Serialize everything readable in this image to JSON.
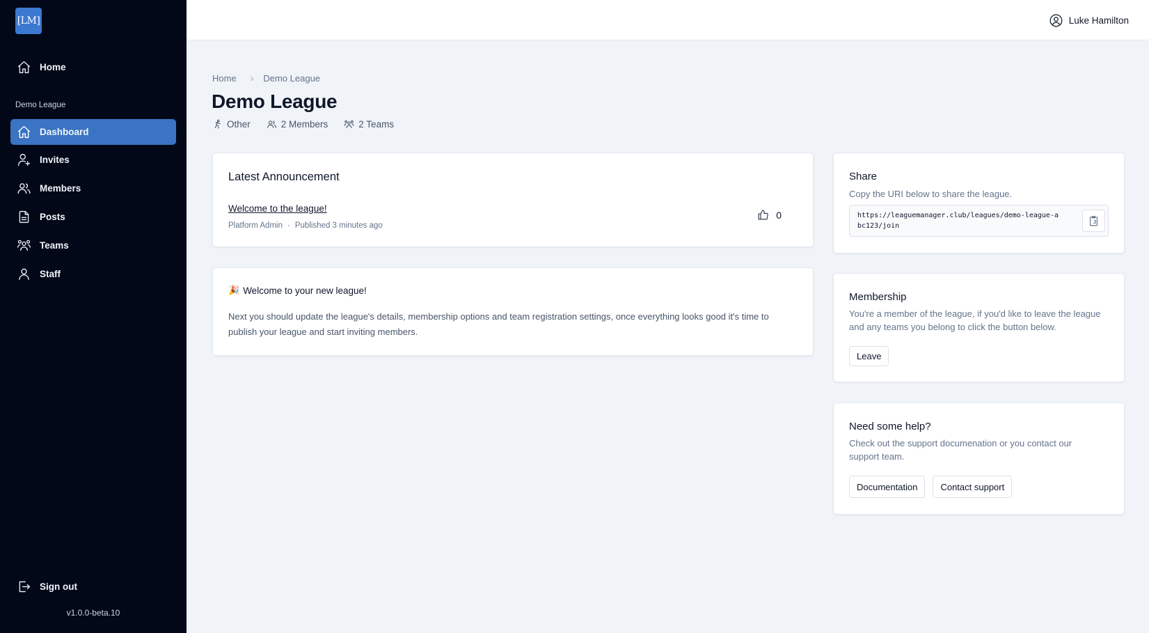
{
  "app": {
    "logo_text": "[LM]",
    "version": "v1.0.0-beta.10"
  },
  "user": {
    "name": "Luke Hamilton"
  },
  "sidebar": {
    "home": "Home",
    "section": "Demo League",
    "items": [
      {
        "label": "Dashboard",
        "icon": "home-icon",
        "active": true
      },
      {
        "label": "Invites",
        "icon": "user-plus-icon"
      },
      {
        "label": "Members",
        "icon": "users-icon"
      },
      {
        "label": "Posts",
        "icon": "document-icon"
      },
      {
        "label": "Teams",
        "icon": "user-group-icon"
      },
      {
        "label": "Staff",
        "icon": "user-icon"
      }
    ],
    "sign_out": "Sign out"
  },
  "breadcrumb": {
    "home": "Home",
    "current": "Demo League"
  },
  "page": {
    "title": "Demo League",
    "meta": {
      "sport": "Other",
      "members": "2 Members",
      "teams": "2 Teams"
    }
  },
  "announcement": {
    "heading": "Latest Announcement",
    "title": "Welcome to the league!",
    "author": "Platform Admin",
    "published": "Published 3 minutes ago",
    "likes": "0"
  },
  "welcome": {
    "emoji": "🎉",
    "title": "Welcome to your new league!",
    "body": "Next you should update the league's details, membership options and team registration settings, once everything looks good it's time to publish your league and start inviting members."
  },
  "share": {
    "title": "Share",
    "description": "Copy the URI below to share the league.",
    "uri": "https://leaguemanager.club/leagues/demo-league-abc123/join"
  },
  "membership": {
    "title": "Membership",
    "description": "You're a member of the league, if you'd like to leave the league and any teams you belong to click the button below.",
    "leave_label": "Leave"
  },
  "help": {
    "title": "Need some help?",
    "description": "Check out the support documenation or you contact our support team.",
    "documentation_label": "Documentation",
    "contact_label": "Contact support"
  },
  "colors": {
    "sidebar_bg": "#020817",
    "accent": "#3a74c2",
    "page_bg": "#f0f3f8"
  }
}
